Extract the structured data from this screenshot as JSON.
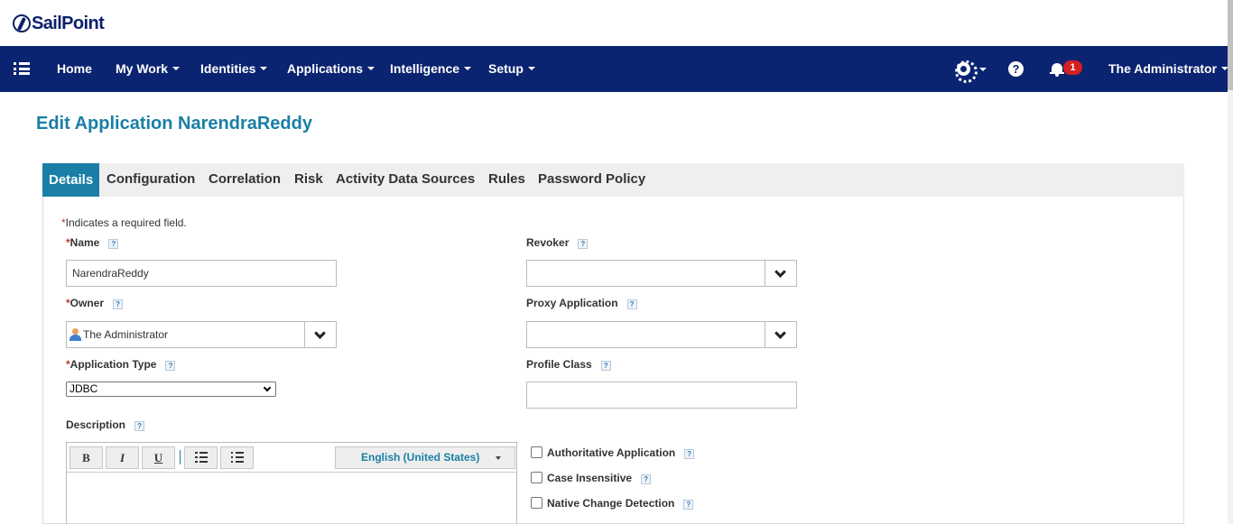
{
  "brand": {
    "name": "SailPoint"
  },
  "nav": {
    "items": [
      {
        "label": "Home"
      },
      {
        "label": "My Work"
      },
      {
        "label": "Identities"
      },
      {
        "label": "Applications"
      },
      {
        "label": "Intelligence"
      },
      {
        "label": "Setup"
      }
    ],
    "notification_count": "1",
    "user": "The Administrator",
    "bg_color": "#0b2471"
  },
  "page": {
    "title": "Edit Application NarendraReddy",
    "accent_color": "#1a7fa6"
  },
  "tabs": [
    {
      "label": "Details",
      "active": true
    },
    {
      "label": "Configuration"
    },
    {
      "label": "Correlation"
    },
    {
      "label": "Risk"
    },
    {
      "label": "Activity Data Sources"
    },
    {
      "label": "Rules"
    },
    {
      "label": "Password Policy"
    }
  ],
  "form": {
    "required_star": "*",
    "required_note": "Indicates a required field.",
    "help_glyph": "?",
    "name": {
      "label": "Name",
      "value": "NarendraReddy"
    },
    "owner": {
      "label": "Owner",
      "value": "The Administrator"
    },
    "application_type": {
      "label": "Application Type",
      "value": "JDBC"
    },
    "description": {
      "label": "Description"
    },
    "revoker": {
      "label": "Revoker",
      "value": ""
    },
    "proxy_application": {
      "label": "Proxy Application",
      "value": ""
    },
    "profile_class": {
      "label": "Profile Class",
      "value": ""
    },
    "checkboxes": [
      {
        "label": "Authoritative Application",
        "checked": false
      },
      {
        "label": "Case Insensitive",
        "checked": false
      },
      {
        "label": "Native Change Detection",
        "checked": false
      }
    ]
  },
  "editor": {
    "bold": "B",
    "italic": "I",
    "underline": "U",
    "language": "English (United States)"
  }
}
